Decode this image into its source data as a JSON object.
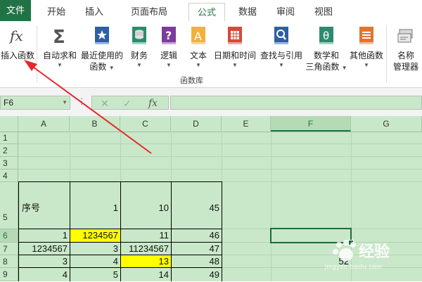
{
  "ribbon_tabs": [
    {
      "label": "文件"
    },
    {
      "label": "开始"
    },
    {
      "label": "插入"
    },
    {
      "label": "页面布局"
    },
    {
      "label": "公式"
    },
    {
      "label": "数据"
    },
    {
      "label": "审阅"
    },
    {
      "label": "视图"
    }
  ],
  "ribbon": {
    "insert_function": {
      "icon": "fx-icon",
      "label": "插入函数"
    },
    "autosum": {
      "icon": "sigma-icon",
      "label": "自动求和"
    },
    "recent": {
      "icon": "star-book-icon",
      "label": "最近使用的",
      "label2": "函数"
    },
    "financial": {
      "icon": "coins-book-icon",
      "label": "财务"
    },
    "logical": {
      "icon": "question-book-icon",
      "label": "逻辑"
    },
    "text": {
      "icon": "letter-a-book-icon",
      "label": "文本"
    },
    "datetime": {
      "icon": "calendar-book-icon",
      "label": "日期和时间"
    },
    "lookup": {
      "icon": "magnifier-book-icon",
      "label": "查找与引用"
    },
    "math": {
      "icon": "theta-book-icon",
      "label": "数学和",
      "label2": "三角函数"
    },
    "more": {
      "icon": "more-book-icon",
      "label": "其他函数"
    },
    "name_manager": {
      "icon": "name-tags-icon",
      "label": "名称",
      "label2": "管理器"
    },
    "group_label": "函数库"
  },
  "formula_bar": {
    "name_box": "F6",
    "fx_label": "fx",
    "content": ""
  },
  "columns": [
    "A",
    "B",
    "C",
    "D",
    "E",
    "F",
    "G"
  ],
  "rows": [
    "1",
    "2",
    "3",
    "4",
    "5",
    "6",
    "7",
    "8",
    "9"
  ],
  "cells": {
    "A5": "序号",
    "B5": "1",
    "C5": "10",
    "D5": "45",
    "A6": "1",
    "B6": "1234567",
    "C6": "11",
    "D6": "46",
    "A7": "1234567",
    "B7": "3",
    "C7": "11234567",
    "D7": "47",
    "A8": "3",
    "B8": "4",
    "C8": "13",
    "D8": "48",
    "F8": "52",
    "A9": "4",
    "B9": "5",
    "C9": "14",
    "D9": "49"
  },
  "colors": {
    "excel_green": "#217346",
    "grid_background": "#c9e8c9",
    "highlight": "#ffff00",
    "arrow": "#e8262c"
  },
  "watermark": {
    "brand": "Baidu",
    "text": "经验",
    "url": "jingyan.baidu.com"
  }
}
